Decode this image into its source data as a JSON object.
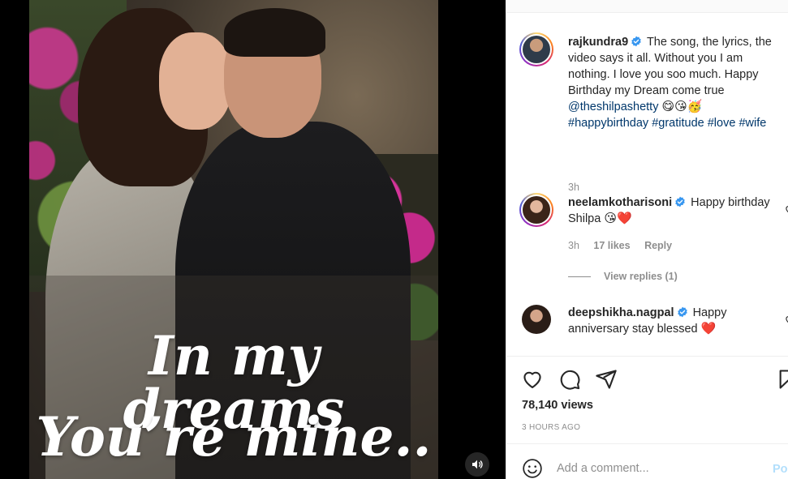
{
  "media": {
    "caption_line_1": "In my dreams",
    "caption_line_2": "You’re mine..",
    "mute_icon": "volume-icon"
  },
  "post": {
    "author": "rajkundra9",
    "verified": true,
    "text": "The song, the lyrics, the video says it all. Without you I am nothing. I love you soo much. Happy Birthday my Dream come true",
    "mention": "@theshilpashetty",
    "emojis": "😋😘🥳",
    "hashtags": [
      "#happybirthday",
      "#gratitude",
      "#love",
      "#wife"
    ],
    "time": "3h"
  },
  "comments": [
    {
      "username": "neelamkotharisoni",
      "verified": true,
      "text": "Happy birthday Shilpa",
      "emojis": "😘❤️",
      "time": "3h",
      "likes": "17 likes",
      "reply_label": "Reply",
      "view_replies": "View replies (1)"
    },
    {
      "username": "deepshikha.nagpal",
      "verified": true,
      "text": "Happy anniversary stay blessed",
      "emojis": "❤️"
    }
  ],
  "actions": {
    "like_icon": "heart-icon",
    "comment_icon": "comment-icon",
    "share_icon": "share-icon",
    "save_icon": "bookmark-icon"
  },
  "stats": {
    "views": "78,140 views",
    "timestamp": "3 HOURS AGO"
  },
  "composer": {
    "placeholder": "Add a comment...",
    "post_label": "Po"
  },
  "colors": {
    "link": "#00376b",
    "verified": "#3897f0",
    "heart_red": "#ed4956",
    "muted": "#8e8e8e",
    "post_disabled": "#b2dffc"
  }
}
